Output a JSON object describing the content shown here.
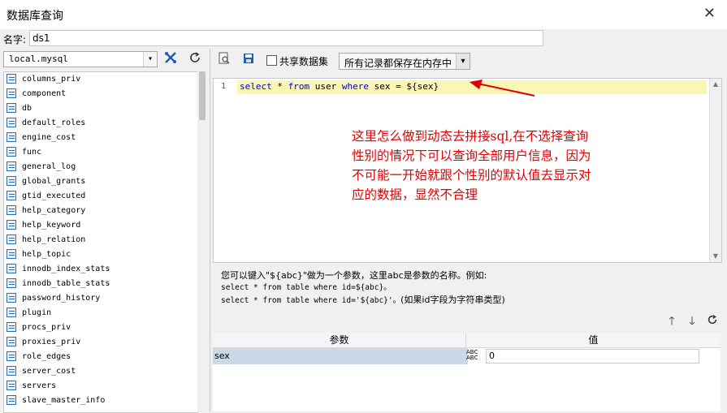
{
  "window": {
    "title": "数据库查询",
    "close": "✕"
  },
  "name_field": {
    "label": "名字:",
    "value": "ds1"
  },
  "db_toolbar": {
    "connection": "local.mysql"
  },
  "tables": [
    "columns_priv",
    "component",
    "db",
    "default_roles",
    "engine_cost",
    "func",
    "general_log",
    "global_grants",
    "gtid_executed",
    "help_category",
    "help_keyword",
    "help_relation",
    "help_topic",
    "innodb_index_stats",
    "innodb_table_stats",
    "password_history",
    "plugin",
    "procs_priv",
    "proxies_priv",
    "role_edges",
    "server_cost",
    "servers",
    "slave_master_info"
  ],
  "query_toolbar": {
    "share_dataset_label": "共享数据集",
    "memory_mode": "所有记录都保存在内存中"
  },
  "editor": {
    "line_number": "1",
    "tokens": {
      "select": "select",
      "star": " * ",
      "from": "from",
      "table": " user ",
      "where": "where",
      "rest": " sex = ${sex}"
    }
  },
  "annotation": "这里怎么做到动态去拼接sql,在不选择查询性别的情况下可以查询全部用户信息，因为不可能一开始就跟个性别的默认值去显示对应的数据，显然不合理",
  "help": {
    "line1": "您可以键入\"${abc}\"做为一个参数，这里abc是参数的名称。例如:",
    "line2": "select * from table where id=${abc}。",
    "line3a": "select * from table where id='${abc}'。",
    "line3b": "(如果id字段为字符串类型)"
  },
  "params": {
    "col_name": "参数",
    "col_value": "值",
    "rows": [
      {
        "name": "sex",
        "type_top": "ABC",
        "type_bottom": "ABC",
        "value": "0"
      }
    ]
  },
  "colors": {
    "annotation": "#e00000",
    "keyword": "#0000cc",
    "current_line": "#fbf6b6",
    "param_row": "#c9d9e8"
  }
}
